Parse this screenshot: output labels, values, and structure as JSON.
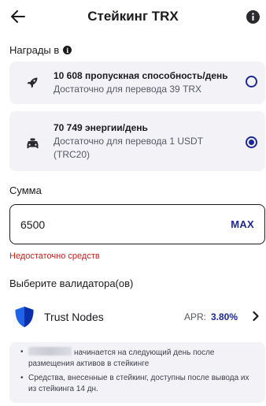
{
  "header": {
    "title": "Стейкинг TRX",
    "back_icon": "arrow-left-icon",
    "info_icon": "info-icon"
  },
  "rewards": {
    "label": "Награды в",
    "options": [
      {
        "icon": "rocket-icon",
        "title": "10 608 пропускная способность/день",
        "subtitle": "Достаточно для перевода 39 TRX",
        "selected": false
      },
      {
        "icon": "car-icon",
        "title": "70 749 энергии/день",
        "subtitle": "Достаточно для перевода 1 USDT (TRC20)",
        "selected": true
      }
    ]
  },
  "amount": {
    "label": "Сумма",
    "value": "6500",
    "max_label": "MAX",
    "error": "Недостаточно средств"
  },
  "validator": {
    "label": "Выберите валидатора(ов)",
    "name": "Trust Nodes",
    "apr_label": "APR:",
    "apr_value": "3.80%"
  },
  "notes": [
    "начинается на следующий день после размещения активов в стейкинге",
    "Средства, внесенные в стейкинг, доступны после вывода их из стейкинга 14 дн."
  ],
  "colors": {
    "accent": "#1c2a8f",
    "error": "#c5221f",
    "card_bg": "#f3f3f7",
    "shield_blue": "#1f63e8"
  }
}
